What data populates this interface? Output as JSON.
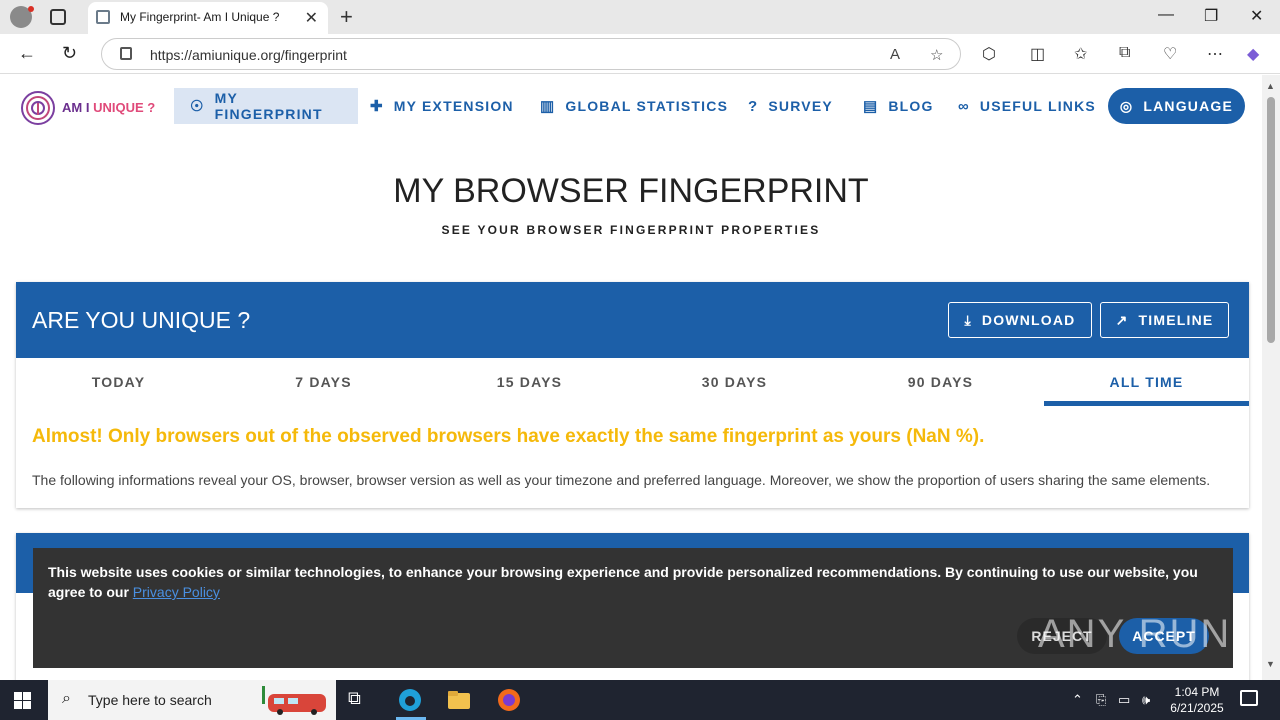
{
  "browser": {
    "tab_title": "My Fingerprint- Am I Unique ?",
    "url": "https://amiunique.org/fingerprint"
  },
  "site": {
    "logo_text_1": "AM I ",
    "logo_text_2": "UNIQUE ?",
    "nav": [
      {
        "label": "MY FINGERPRINT",
        "icon": "fingerprint-icon"
      },
      {
        "label": "MY EXTENSION",
        "icon": "puzzle-icon"
      },
      {
        "label": "GLOBAL STATISTICS",
        "icon": "bar-chart-icon"
      },
      {
        "label": "SURVEY",
        "icon": "question-icon"
      },
      {
        "label": "BLOG",
        "icon": "blog-icon"
      },
      {
        "label": "USEFUL LINKS",
        "icon": "link-icon"
      }
    ],
    "language_label": "LANGUAGE"
  },
  "hero": {
    "title": "MY BROWSER FINGERPRINT",
    "subtitle": "SEE YOUR BROWSER FINGERPRINT PROPERTIES"
  },
  "card": {
    "title": "ARE YOU UNIQUE ?",
    "download_label": "DOWNLOAD",
    "timeline_label": "TIMELINE",
    "tabs": [
      "TODAY",
      "7 DAYS",
      "15 DAYS",
      "30 DAYS",
      "90 DAYS",
      "ALL TIME"
    ],
    "active_tab": "ALL TIME",
    "result": "Almost! Only browsers out of the observed browsers have exactly the same fingerprint as yours (NaN %).",
    "info": "The following informations reveal your OS, browser, browser version as well as your timezone and preferred language. Moreover, we show the proportion of users sharing the same elements."
  },
  "cookie": {
    "text": "This website uses cookies or similar technologies, to enhance your browsing experience and provide personalized recommendations. By continuing to use our website, you agree to our ",
    "link": "Privacy Policy",
    "reject": "REJECT",
    "accept": "ACCEPT",
    "watermark": "ANY RUN"
  },
  "taskbar": {
    "search_placeholder": "Type here to search",
    "time": "1:04 PM",
    "date": "6/21/2025"
  },
  "colors": {
    "brand_blue": "#1c5fa8",
    "warning_yellow": "#f5b90a"
  }
}
